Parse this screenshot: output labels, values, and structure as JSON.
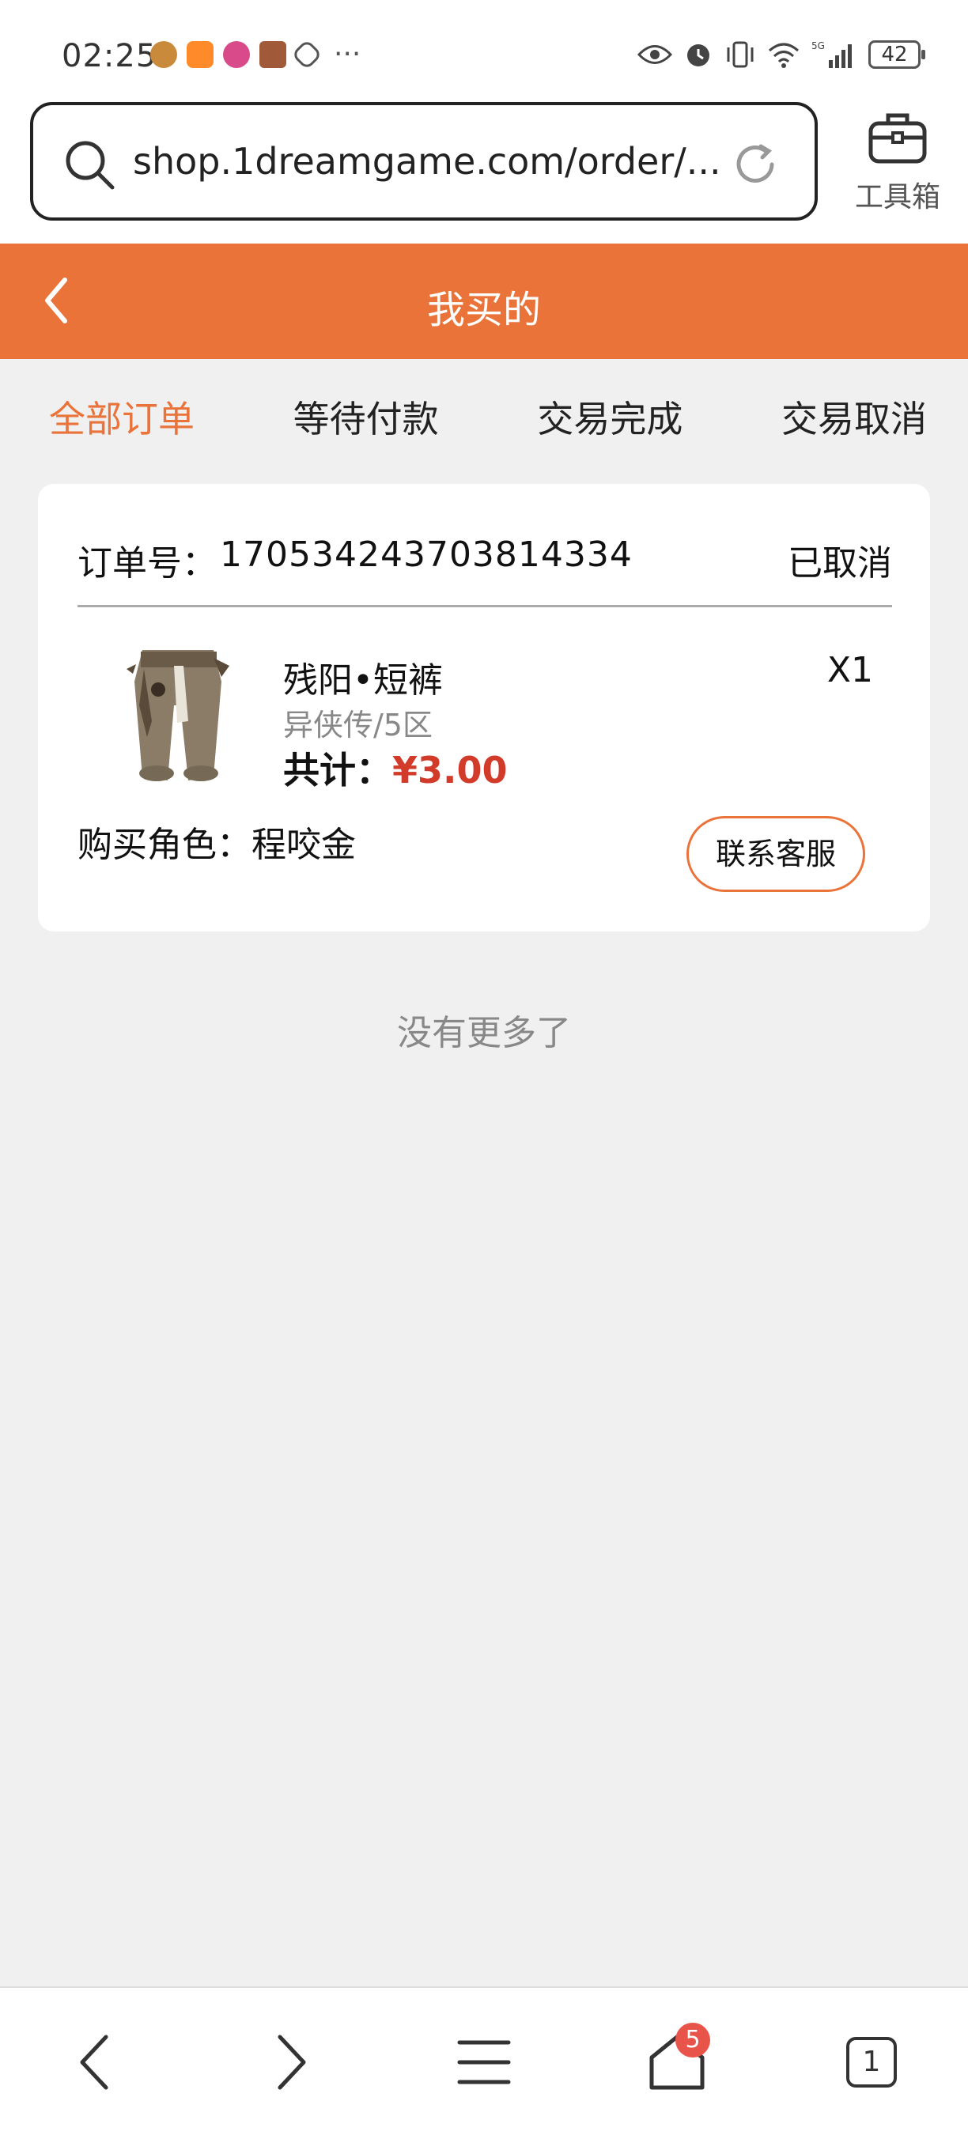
{
  "status_bar": {
    "time": "02:25",
    "notifications_more": "···",
    "network": "5G",
    "battery": "42"
  },
  "browser": {
    "url": "shop.1dreamgame.com/order/...",
    "toolbox_label": "工具箱"
  },
  "header": {
    "title": "我买的"
  },
  "tabs": [
    {
      "label": "全部订单",
      "active": true
    },
    {
      "label": "等待付款",
      "active": false
    },
    {
      "label": "交易完成",
      "active": false
    },
    {
      "label": "交易取消",
      "active": false
    }
  ],
  "order": {
    "number_label": "订单号：",
    "number": "170534243703814334",
    "status": "已取消",
    "item_name": "残阳•短裤",
    "quantity": "X1",
    "server": "异侠传/5区",
    "total_label": "共计：",
    "total_price": "¥3.00",
    "buyer_label": "购买角色：",
    "buyer_name": "程咬金",
    "contact_button": "联系客服"
  },
  "no_more_text": "没有更多了",
  "bottom_nav": {
    "home_badge": "5",
    "tab_count": "1"
  },
  "colors": {
    "accent": "#ea733a",
    "price": "#d23a2a",
    "background": "#f0f0f0"
  }
}
